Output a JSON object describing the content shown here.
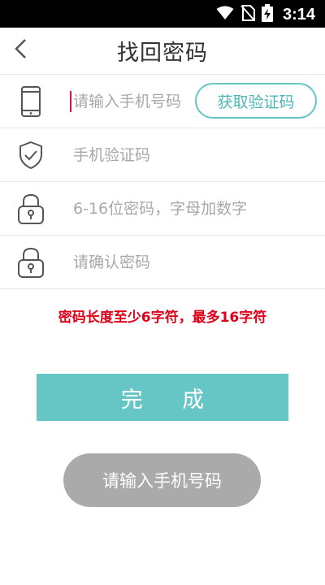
{
  "status_bar": {
    "time": "3:14",
    "icons": [
      "wifi-icon",
      "no-sim-icon",
      "battery-charging-icon"
    ]
  },
  "header": {
    "title": "找回密码",
    "back_icon": "chevron-left-icon"
  },
  "form": {
    "phone": {
      "icon": "phone-icon",
      "placeholder": "请输入手机号码",
      "value": ""
    },
    "get_code_label": "获取验证码",
    "code": {
      "icon": "shield-check-icon",
      "placeholder": "手机验证码",
      "value": ""
    },
    "password": {
      "icon": "lock-icon",
      "placeholder": "6-16位密码，字母加数字",
      "value": ""
    },
    "confirm_password": {
      "icon": "lock-icon",
      "placeholder": "请确认密码",
      "value": ""
    }
  },
  "hint_text": "密码长度至少6字符，最多16字符",
  "done_label": "完 成",
  "toast_text": "请输入手机号码",
  "colors": {
    "accent": "#66c6c6",
    "error": "#e0001a",
    "toast_bg": "#aaaaaa",
    "caret": "#c2185b"
  }
}
